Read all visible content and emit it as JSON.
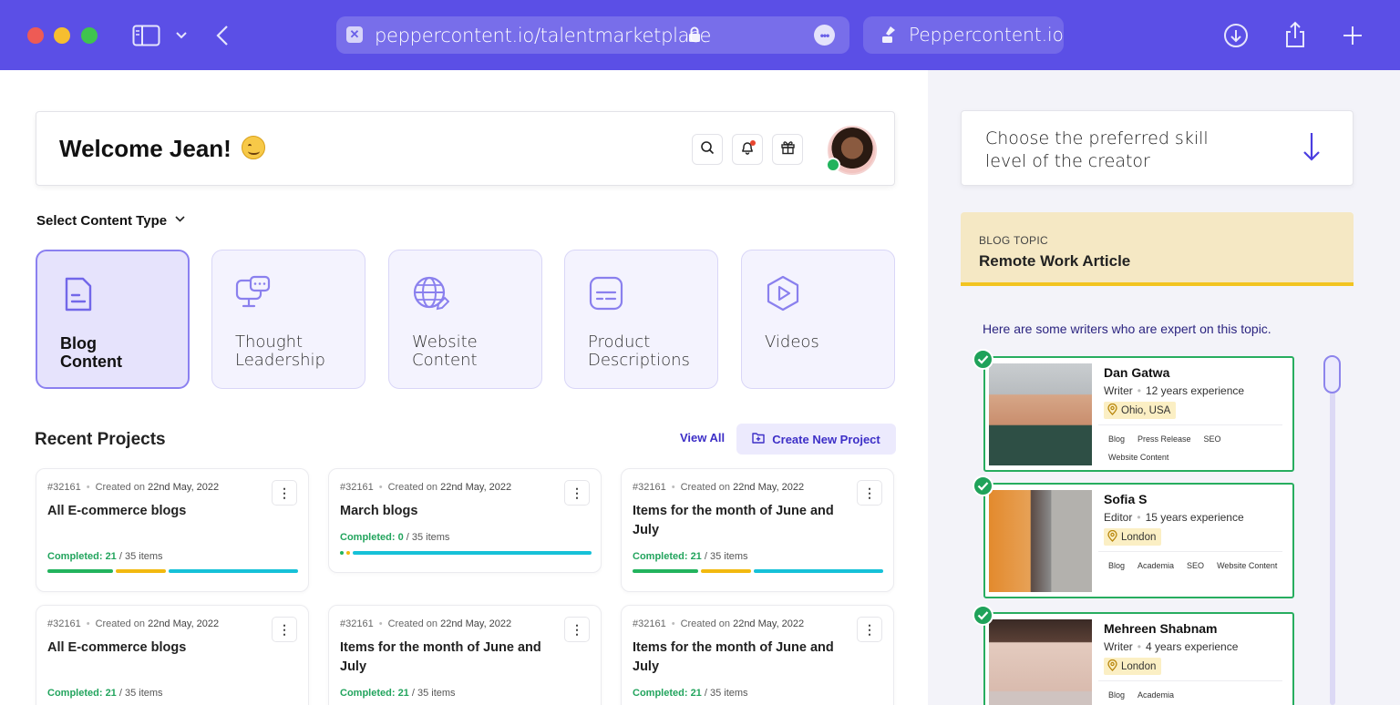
{
  "browser": {
    "url": "peppercontent.io/talentmarketplace",
    "tab_title": "Peppercontent.io"
  },
  "welcome": {
    "title": "Welcome Jean!"
  },
  "content_type": {
    "label": "Select Content Type",
    "items": [
      {
        "label": "Blog\nContent",
        "icon": "document-icon",
        "active": true
      },
      {
        "label": "Thought\nLeadership",
        "icon": "monitor-chat-icon",
        "active": false
      },
      {
        "label": "Website\nContent",
        "icon": "globe-edit-icon",
        "active": false
      },
      {
        "label": "Product\nDescriptions",
        "icon": "text-box-icon",
        "active": false
      },
      {
        "label": "Videos",
        "icon": "play-icon",
        "active": false
      }
    ]
  },
  "recent": {
    "title": "Recent Projects",
    "view_all": "View All",
    "create_label": "Create New Project",
    "projects": [
      {
        "id": "#32161",
        "created_label": "Created on",
        "date": "22nd May, 2022",
        "title": "All E-commerce blogs",
        "completed_label": "Completed:",
        "completed": "21",
        "total": "/ 35 items",
        "progress": 0.6
      },
      {
        "id": "#32161",
        "created_label": "Created on",
        "date": "22nd May, 2022",
        "title": "March blogs",
        "completed_label": "Completed:",
        "completed": "0",
        "total": "/ 35 items",
        "progress": 0.0
      },
      {
        "id": "#32161",
        "created_label": "Created on",
        "date": "22nd May, 2022",
        "title": "Items for the month of June and July",
        "completed_label": "Completed:",
        "completed": "21",
        "total": "/ 35 items",
        "progress": 0.6
      },
      {
        "id": "#32161",
        "created_label": "Created on",
        "date": "22nd May, 2022",
        "title": "All E-commerce blogs",
        "completed_label": "Completed:",
        "completed": "21",
        "total": "/ 35 items",
        "progress": 0.6
      },
      {
        "id": "#32161",
        "created_label": "Created on",
        "date": "22nd May, 2022",
        "title": "Items for the month of June and July",
        "completed_label": "Completed:",
        "completed": "21",
        "total": "/ 35 items",
        "progress": 0.6
      },
      {
        "id": "#32161",
        "created_label": "Created on",
        "date": "22nd May, 2022",
        "title": "Items for the month of June and July",
        "completed_label": "Completed:",
        "completed": "21",
        "total": "/ 35 items",
        "progress": 0.6
      }
    ]
  },
  "skill": {
    "text": "Choose the preferred skill level of the creator"
  },
  "topic": {
    "label": "BLOG TOPIC",
    "title": "Remote Work Article"
  },
  "experts_text": "Here are some writers who are expert on this topic.",
  "writers": [
    {
      "name": "Dan Gatwa",
      "role": "Writer",
      "experience": "12 years experience",
      "location": "Ohio, USA",
      "tags": [
        "Blog",
        "Press Release",
        "SEO",
        "Website Content"
      ]
    },
    {
      "name": "Sofia S",
      "role": "Editor",
      "experience": "15 years experience",
      "location": "London",
      "tags": [
        "Blog",
        "Academia",
        "SEO",
        "Website Content"
      ]
    },
    {
      "name": "Mehreen Shabnam",
      "role": "Writer",
      "experience": "4 years experience",
      "location": "London",
      "tags": [
        "Blog",
        "Academia"
      ]
    }
  ],
  "colors": {
    "browser_bar": "#5b4fe6",
    "accent": "#3d2fc7",
    "success": "#27ad5f",
    "topic_bg": "#f5e8c4",
    "progress_green": "#22b35d",
    "progress_yellow": "#f2b90f",
    "progress_cyan": "#16c1d8"
  }
}
